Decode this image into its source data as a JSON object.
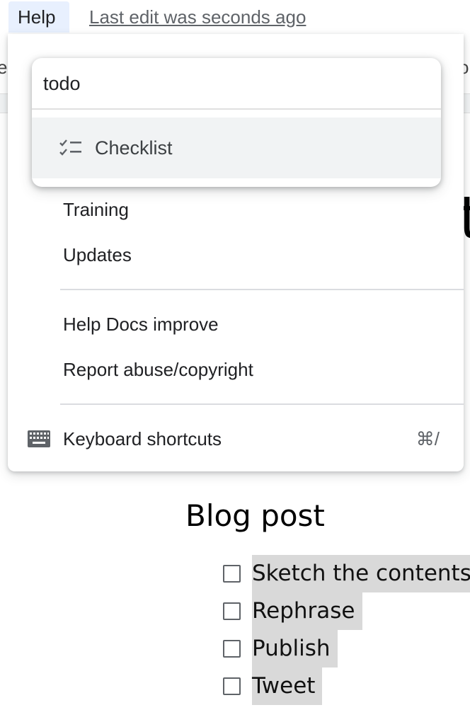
{
  "menubar": {
    "help_label": "Help",
    "last_edit": "Last edit was seconds ago"
  },
  "search": {
    "value": "todo",
    "results": [
      {
        "label": "Checklist",
        "icon": "checklist-icon"
      }
    ]
  },
  "help_menu": {
    "items": [
      {
        "label": "Training"
      },
      {
        "label": "Updates"
      },
      {
        "label": "Help Docs improve"
      },
      {
        "label": "Report abuse/copyright"
      },
      {
        "label": "Keyboard shortcuts",
        "icon": "keyboard-icon",
        "shortcut": "⌘/"
      }
    ]
  },
  "document": {
    "title": "Blog post",
    "checklist": [
      {
        "text": "Sketch the contents",
        "checked": false
      },
      {
        "text": "Rephrase",
        "checked": false
      },
      {
        "text": "Publish",
        "checked": false
      },
      {
        "text": "Tweet",
        "checked": false
      }
    ],
    "peek_glyph": "t"
  },
  "colors": {
    "menu_active_bg": "#e8f0fe",
    "result_highlight": "#f1f3f4",
    "text_highlight": "#d9d9d9"
  }
}
